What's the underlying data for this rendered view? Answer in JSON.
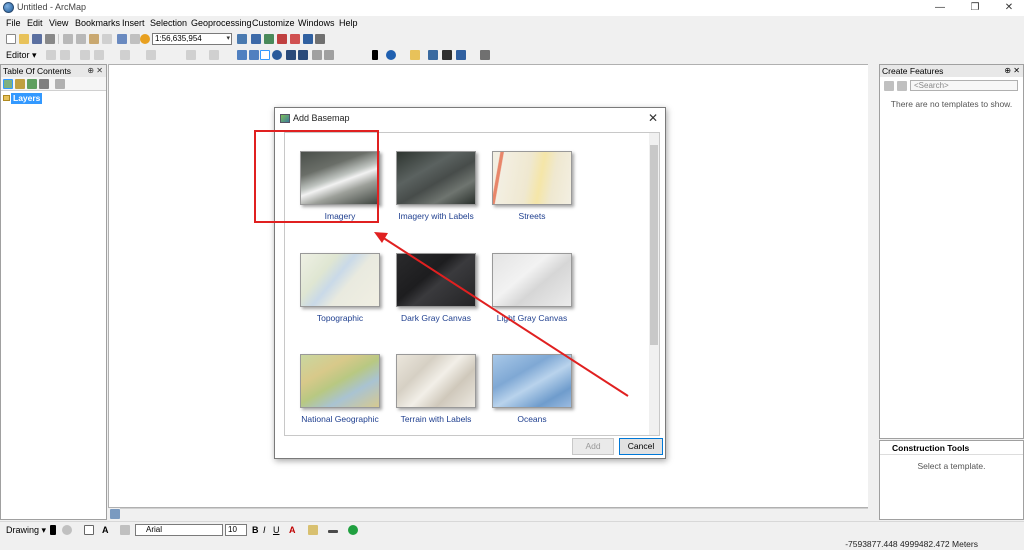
{
  "window": {
    "title": "Untitled - ArcMap",
    "min": "—",
    "restore": "❐",
    "close": "✕"
  },
  "menu": [
    "File",
    "Edit",
    "View",
    "Bookmarks",
    "Insert",
    "Selection",
    "Geoprocessing",
    "Customize",
    "Windows",
    "Help"
  ],
  "toolbar": {
    "scale": "1:56,635,954",
    "editor_label": "Editor ▾"
  },
  "toc": {
    "title": "Table Of Contents",
    "pin": "⊕ ✕",
    "root_layer": "Layers"
  },
  "create_features": {
    "title": "Create Features",
    "pin": "⊕ ✕",
    "search_placeholder": "<Search>",
    "empty_message": "There are no templates to show."
  },
  "construction_tools": {
    "title": "Construction Tools",
    "message": "Select a template."
  },
  "drawing_toolbar": {
    "drawing_label": "Drawing ▾",
    "font": "Arial",
    "font_size": "10",
    "bold": "B",
    "italic": "I",
    "underline": "U",
    "font_color_letter": "A"
  },
  "status": {
    "coordinates": "-7593877.448  4999482.472 Meters"
  },
  "dialog": {
    "title": "Add Basemap",
    "close": "✕",
    "basemaps": [
      {
        "label": "Imagery",
        "icon": "imagery-thumbnail"
      },
      {
        "label": "Imagery with Labels",
        "icon": "imagery-labels-thumbnail"
      },
      {
        "label": "Streets",
        "icon": "streets-thumbnail"
      },
      {
        "label": "Topographic",
        "icon": "topographic-thumbnail"
      },
      {
        "label": "Dark Gray Canvas",
        "icon": "dark-gray-thumbnail"
      },
      {
        "label": "Light Gray Canvas",
        "icon": "light-gray-thumbnail"
      },
      {
        "label": "National Geographic",
        "icon": "national-geographic-thumbnail"
      },
      {
        "label": "Terrain with Labels",
        "icon": "terrain-thumbnail"
      },
      {
        "label": "Oceans",
        "icon": "oceans-thumbnail"
      }
    ],
    "add_button": "Add",
    "cancel_button": "Cancel"
  },
  "colors": {
    "highlight": "#e02020",
    "selection": "#3399ff",
    "tile_label": "#1f3f8f"
  }
}
